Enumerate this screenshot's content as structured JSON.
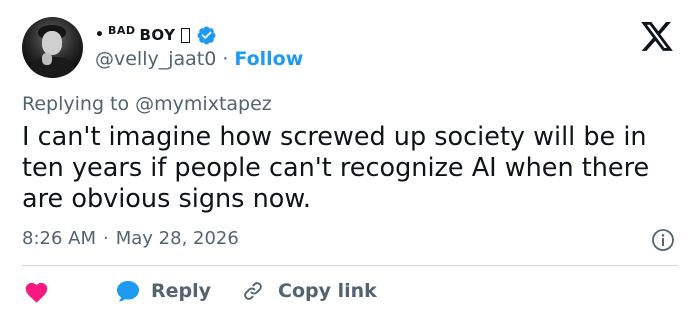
{
  "author": {
    "display_name_prefix": "•",
    "display_name_sup": "BAD",
    "display_name_main": "BOY",
    "verified": true,
    "handle": "@velly_jaat0",
    "follow_separator": "·",
    "follow_label": "Follow"
  },
  "reply_context": {
    "text": "Replying to @mymixtapez"
  },
  "tweet": {
    "text": "I can't imagine how screwed up society will be in ten years if people can't recognize AI when there are obvious signs now."
  },
  "meta": {
    "time": "8:26 AM",
    "separator": "·",
    "date": "May 28, 2026"
  },
  "actions": {
    "reply_label": "Reply",
    "copy_link_label": "Copy link"
  },
  "icons": {
    "logo": "x-logo-icon",
    "verified": "verified-badge-icon",
    "info": "info-icon",
    "like": "heart-icon",
    "reply": "reply-bubble-icon",
    "copy": "link-icon"
  },
  "colors": {
    "accent": "#1d9bf0",
    "heart": "#f91880",
    "secondary_text": "#536471",
    "primary_text": "#0f1419",
    "divider": "#cfd9de"
  }
}
